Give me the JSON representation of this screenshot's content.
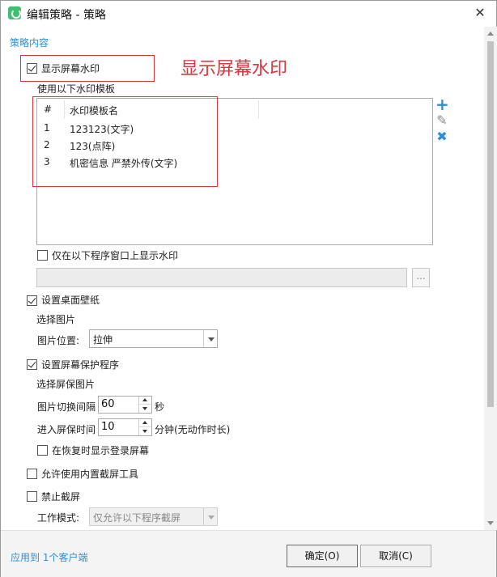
{
  "window": {
    "title": "编辑策略 - 策略",
    "close_glyph": "✕"
  },
  "section_title": "策略内容",
  "annotation": "显示屏幕水印",
  "watermark": {
    "checkbox_label": "显示屏幕水印",
    "checked": true,
    "template_list_label": "使用以下水印模板",
    "columns": [
      "#",
      "水印模板名"
    ],
    "rows": [
      {
        "index": "1",
        "name": "123123(文字)"
      },
      {
        "index": "2",
        "name": "123(点阵)"
      },
      {
        "index": "3",
        "name": "机密信息 严禁外传(文字)"
      }
    ],
    "only_windows_label": "仅在以下程序窗口上显示水印",
    "browse_label": "..."
  },
  "wallpaper": {
    "checkbox_label": "设置桌面壁纸",
    "checked": true,
    "choose_image_link": "选择图片",
    "position_label": "图片位置:",
    "position_value": "拉伸"
  },
  "screensaver": {
    "checkbox_label": "设置屏幕保护程序",
    "checked": true,
    "choose_image_link": "选择屏保图片",
    "interval_label": "图片切换间隔",
    "interval_value": "60",
    "interval_unit": "秒",
    "idle_label": "进入屏保时间",
    "idle_value": "10",
    "idle_unit": "分钟(无动作时长)",
    "login_on_resume_label": "在恢复时显示登录屏幕"
  },
  "allow_builtin_screenshot_label": "允许使用内置截屏工具",
  "disable_screenshot": {
    "checkbox_label": "禁止截屏",
    "mode_label": "工作模式:",
    "mode_value": "仅允许以下程序截屏"
  },
  "footer": {
    "apply_link": "应用到 1个客户端",
    "ok_label": "确定(O)",
    "cancel_label": "取消(C)"
  },
  "colors": {
    "accent": "#2b8fd8",
    "annotation_red": "#d9363e",
    "app_icon": "#3fbf6f"
  },
  "icons": {
    "app": "app-logo-icon",
    "add": "plus-icon",
    "edit": "pencil-icon",
    "delete": "x-icon"
  }
}
